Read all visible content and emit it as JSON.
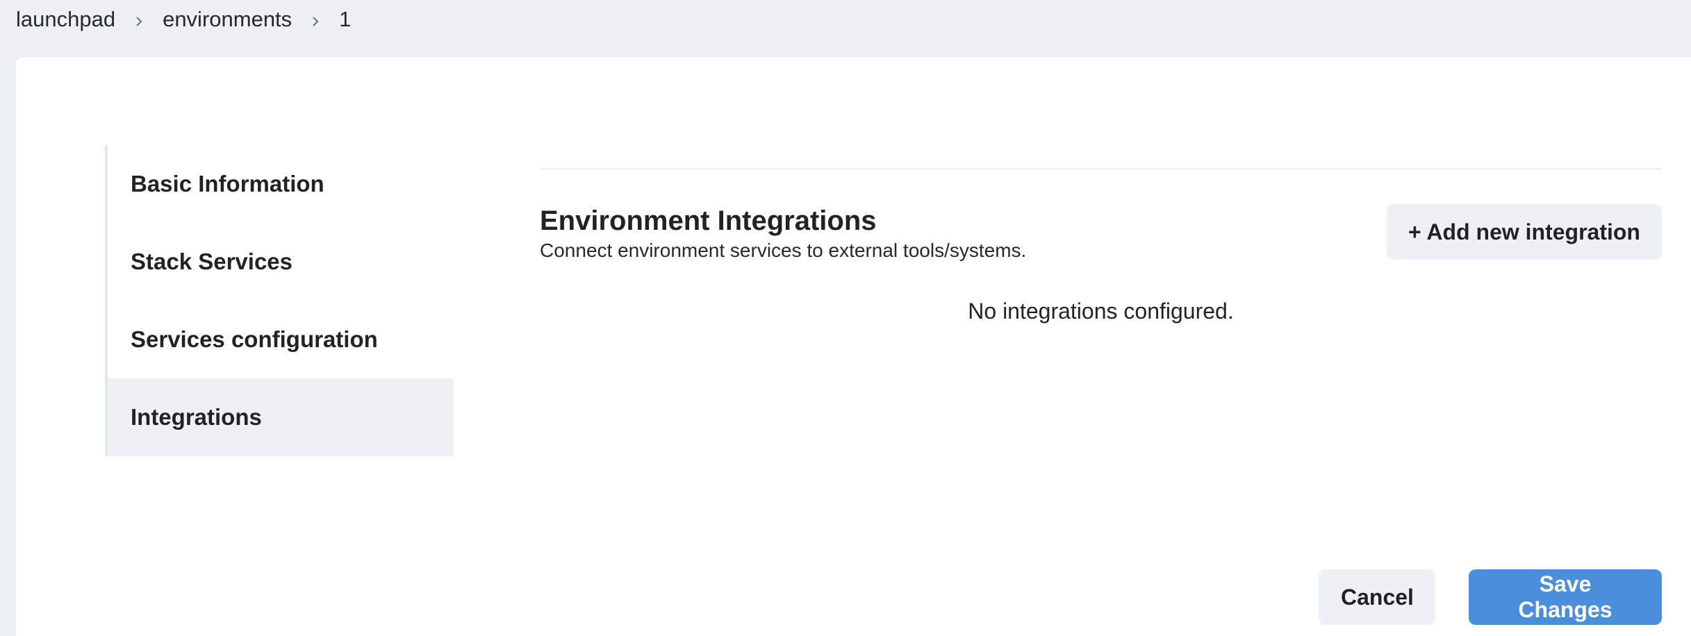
{
  "breadcrumb": {
    "items": [
      "launchpad",
      "environments",
      "1"
    ]
  },
  "sidebar": {
    "items": [
      {
        "label": "Basic Information",
        "active": false
      },
      {
        "label": "Stack Services",
        "active": false
      },
      {
        "label": "Services configuration",
        "active": false
      },
      {
        "label": "Integrations",
        "active": true
      }
    ]
  },
  "integrations": {
    "title": "Environment Integrations",
    "description": "Connect environment services to external tools/systems.",
    "add_button": "+ Add new integration",
    "empty_message": "No integrations configured."
  },
  "footer": {
    "cancel_label": "Cancel",
    "save_label": "Save Changes"
  },
  "colors": {
    "page_background": "#edf0f5",
    "primary_button": "#4a8fdb",
    "active_nav": "#edf0f5"
  },
  "icons": {
    "breadcrumb_separator": "chevron-right-icon"
  }
}
